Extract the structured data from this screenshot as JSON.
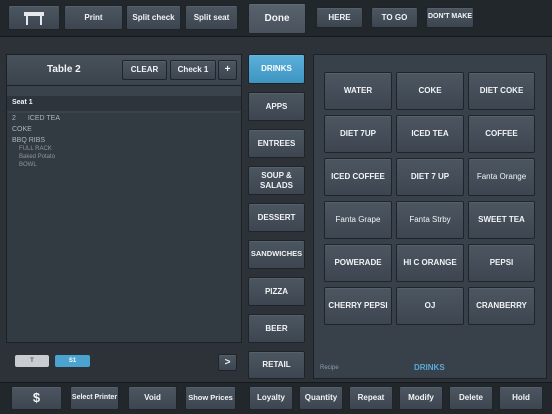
{
  "top_bar": {
    "print": "Print",
    "split_check": "Split check",
    "split_seat": "Split seat",
    "done": "Done",
    "here": "HERE",
    "to_go": "TO GO",
    "dont_make": "DON'T MAKE"
  },
  "order_panel": {
    "table_title": "Table 2",
    "clear": "CLEAR",
    "check": "Check 1",
    "add": "+",
    "seat_label": "Seat 1",
    "lines": [
      {
        "qty": "2",
        "name": "ICED TEA"
      },
      {
        "qty": "",
        "name": "COKE"
      },
      {
        "qty": "",
        "name": "BBQ RIBS"
      },
      {
        "qty": "",
        "name": "FULL RACK"
      },
      {
        "qty": "",
        "name": "Baked Potato"
      },
      {
        "qty": "",
        "name": "BOWL"
      }
    ],
    "seat_tabs": [
      "T",
      "S1"
    ],
    "next": ">"
  },
  "categories": [
    "DRINKS",
    "APPS",
    "ENTREES",
    "SOUP & SALADS",
    "DESSERT",
    "SANDWICHES",
    "PIZZA",
    "BEER",
    "RETAIL"
  ],
  "active_category": "DRINKS",
  "items": [
    "WATER",
    "COKE",
    "DIET COKE",
    "DIET 7UP",
    "ICED TEA",
    "COFFEE",
    "ICED COFFEE",
    "DIET 7 UP",
    "Fanta Orange",
    "Fanta Grape",
    "Fanta Strby",
    "SWEET TEA",
    "POWERADE",
    "HI C ORANGE",
    "PEPSI",
    "CHERRY PEPSI",
    "OJ",
    "CRANBERRY"
  ],
  "items_footer": {
    "recipe": "Recipe",
    "category": "DRINKS"
  },
  "bottom_bar": {
    "dollar": "$",
    "select_printer": "Select Printer",
    "void": "Void",
    "show_prices": "Show Prices",
    "loyalty": "Loyalty",
    "quantity": "Quantity",
    "repeat": "Repeat",
    "modify": "Modify",
    "delete": "Delete",
    "hold": "Hold"
  },
  "colors": {
    "accent": "#4aa3d0",
    "background": "#2c3238"
  },
  "icons": {
    "table": "table-icon"
  }
}
